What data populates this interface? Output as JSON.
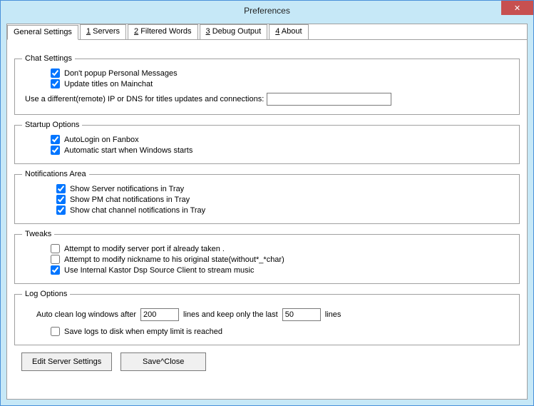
{
  "window": {
    "title": "Preferences"
  },
  "tabs": {
    "general": "General Settings",
    "servers_prefix": "1",
    "servers": " Servers",
    "filtered_prefix": "2",
    "filtered": " Filtered Words",
    "debug_prefix": "3",
    "debug": " Debug Output",
    "about_prefix": "4",
    "about": " About"
  },
  "chat": {
    "legend": "Chat Settings",
    "no_popup": "Don't popup Personal Messages",
    "update_titles": "Update titles on Mainchat",
    "ipdns_label": "Use a different(remote) IP or DNS  for titles updates and connections:",
    "ipdns_value": ""
  },
  "startup": {
    "legend": "Startup Options",
    "autologin": "AutoLogin on Fanbox",
    "autostart": "Automatic start when Windows starts"
  },
  "notify": {
    "legend": "Notifications Area",
    "server": "Show Server notifications in Tray",
    "pm": "Show PM chat notifications in Tray",
    "channel": "Show chat channel notifications in Tray"
  },
  "tweaks": {
    "legend": "Tweaks",
    "port": "Attempt to modify server  port if already taken .",
    "nick": "Attempt to modify nickname to his original  state(without*_*char)",
    "dsp": "Use Internal Kastor Dsp Source Client to stream music"
  },
  "log": {
    "legend": "Log Options",
    "auto_pre": "Auto clean log windows after",
    "lines_val": "200",
    "auto_mid": "lines  and keep only the last",
    "keep_val": "50",
    "auto_post": "lines",
    "save": "Save logs to disk when empty limit is reached"
  },
  "buttons": {
    "edit": "Edit Server Settings",
    "save": "Save^Close"
  }
}
